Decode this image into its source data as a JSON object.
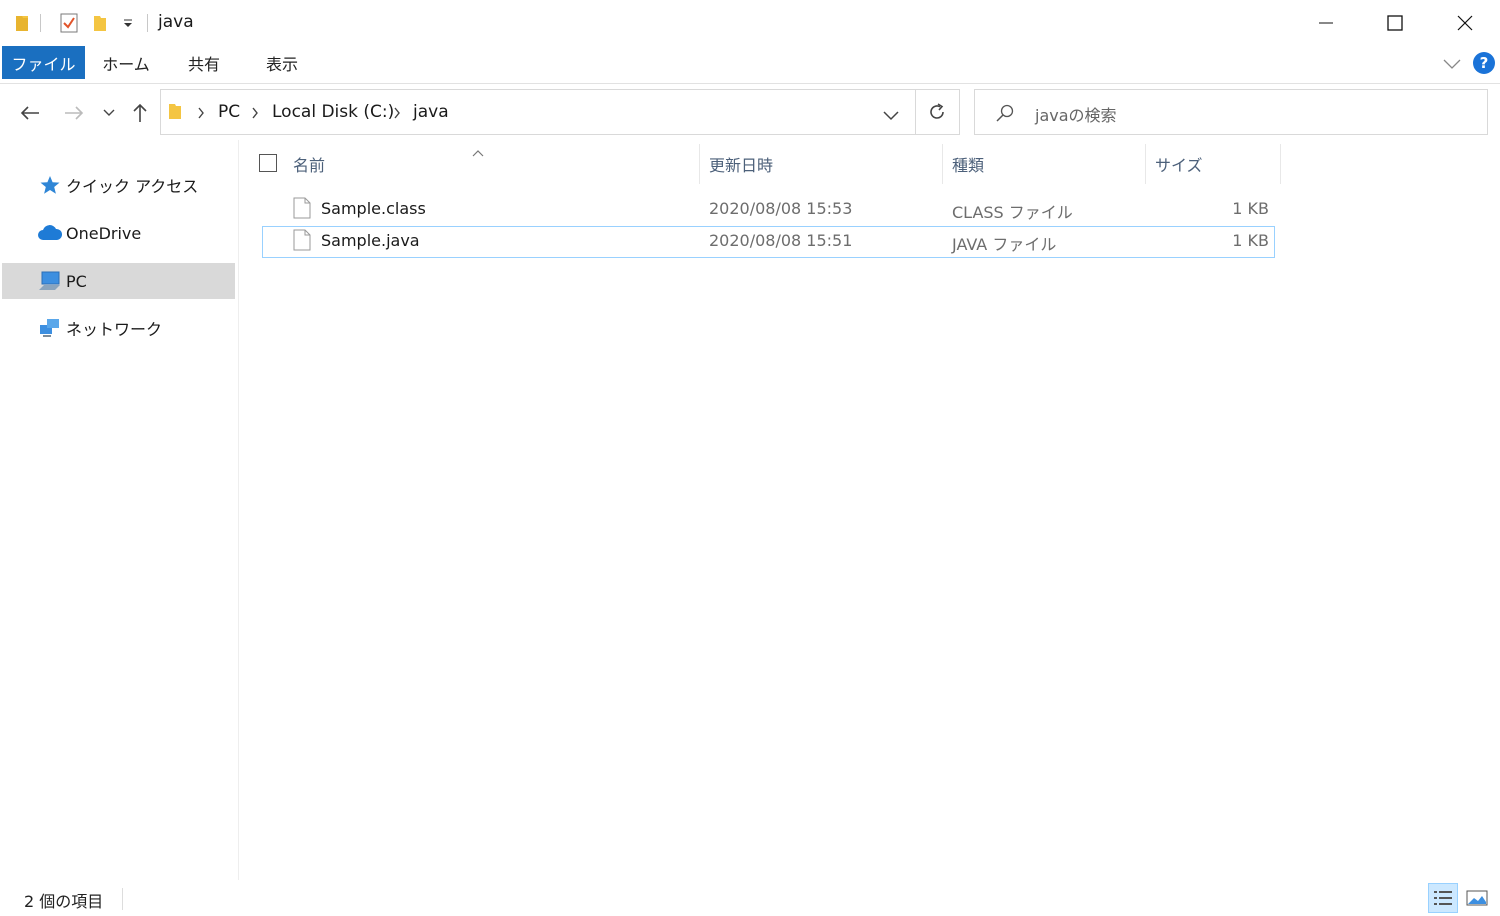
{
  "window": {
    "title": "java"
  },
  "ribbon": {
    "tabs": [
      "ファイル",
      "ホーム",
      "共有",
      "表示"
    ]
  },
  "address": {
    "crumbs": [
      "PC",
      "Local Disk (C:)",
      "java"
    ]
  },
  "search": {
    "placeholder": "javaの検索"
  },
  "sidebar": {
    "items": [
      {
        "label": "クイック アクセス",
        "icon": "star-icon"
      },
      {
        "label": "OneDrive",
        "icon": "cloud-icon"
      },
      {
        "label": "PC",
        "icon": "computer-icon",
        "selected": true
      },
      {
        "label": "ネットワーク",
        "icon": "network-icon"
      }
    ]
  },
  "columns": {
    "name": "名前",
    "modified": "更新日時",
    "type": "種類",
    "size": "サイズ"
  },
  "files": [
    {
      "name": "Sample.class",
      "modified": "2020/08/08 15:53",
      "type": "CLASS ファイル",
      "size": "1 KB"
    },
    {
      "name": "Sample.java",
      "modified": "2020/08/08 15:51",
      "type": "JAVA ファイル",
      "size": "1 KB",
      "selected": true
    }
  ],
  "status": {
    "count": "2 個の項目"
  },
  "colors": {
    "accent": "#1a6fc0",
    "selection_border": "#99d1ff",
    "sidebar_selected": "#d9d9d9",
    "help": "#1a73d8"
  }
}
